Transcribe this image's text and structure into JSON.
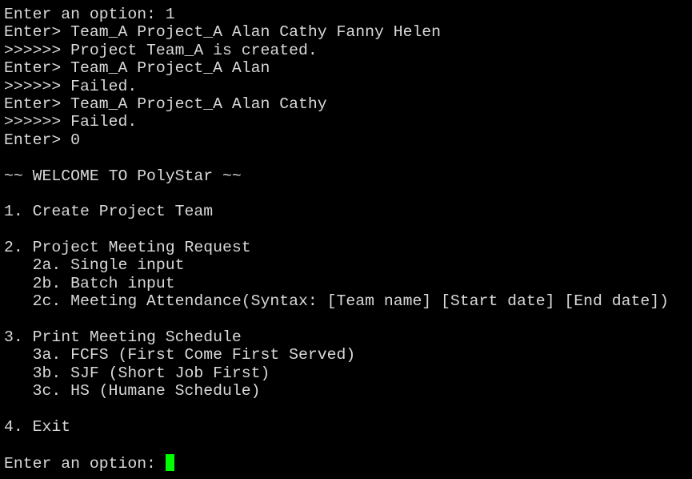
{
  "terminal": {
    "lines": [
      "Enter an option: 1",
      "Enter> Team_A Project_A Alan Cathy Fanny Helen",
      ">>>>>> Project Team_A is created.",
      "Enter> Team_A Project_A Alan",
      ">>>>>> Failed.",
      "Enter> Team_A Project_A Alan Cathy",
      ">>>>>> Failed.",
      "Enter> 0",
      "",
      "~~ WELCOME TO PolyStar ~~",
      "",
      "1. Create Project Team",
      "",
      "2. Project Meeting Request",
      "   2a. Single input",
      "   2b. Batch input",
      "   2c. Meeting Attendance(Syntax: [Team name] [Start date] [End date])",
      "",
      "3. Print Meeting Schedule",
      "   3a. FCFS (First Come First Served)",
      "   3b. SJF (Short Job First)",
      "   3c. HS (Humane Schedule)",
      "",
      "4. Exit",
      ""
    ],
    "prompt": "Enter an option: ",
    "colors": {
      "background": "#000000",
      "foreground": "#d9d9d9",
      "cursor": "#00ff00"
    },
    "cursor_icon": "block-cursor"
  }
}
